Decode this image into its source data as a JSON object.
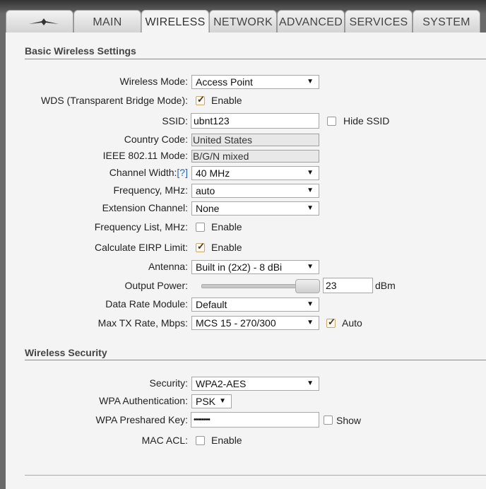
{
  "tabs": [
    {
      "label": "MAIN"
    },
    {
      "label": "WIRELESS"
    },
    {
      "label": "NETWORK"
    },
    {
      "label": "ADVANCED"
    },
    {
      "label": "SERVICES"
    },
    {
      "label": "SYSTEM"
    }
  ],
  "active_tab": "WIRELESS",
  "basic": {
    "title": "Basic Wireless Settings",
    "wireless_mode": {
      "label": "Wireless Mode:",
      "value": "Access Point"
    },
    "wds": {
      "label": "WDS (Transparent Bridge Mode):",
      "option": "Enable",
      "checked": true
    },
    "ssid": {
      "label": "SSID:",
      "value": "ubnt123",
      "hide_label": "Hide SSID",
      "hide_checked": false
    },
    "country": {
      "label": "Country Code:",
      "value": "United States"
    },
    "ieee": {
      "label": "IEEE 802.11 Mode:",
      "value": "B/G/N mixed"
    },
    "channel_width": {
      "label": "Channel Width:",
      "help": "[?]",
      "value": "40 MHz"
    },
    "frequency": {
      "label": "Frequency, MHz:",
      "value": "auto"
    },
    "ext_channel": {
      "label": "Extension Channel:",
      "value": "None"
    },
    "freq_list": {
      "label": "Frequency List, MHz:",
      "option": "Enable",
      "checked": false
    },
    "eirp": {
      "label": "Calculate EIRP Limit:",
      "option": "Enable",
      "checked": true
    },
    "antenna": {
      "label": "Antenna:",
      "value": "Built in (2x2) - 8 dBi"
    },
    "output_power": {
      "label": "Output Power:",
      "value": "23",
      "unit": "dBm"
    },
    "data_rate": {
      "label": "Data Rate Module:",
      "value": "Default"
    },
    "max_tx": {
      "label": "Max TX Rate, Mbps:",
      "value": "MCS 15 - 270/300",
      "auto_label": "Auto",
      "auto_checked": true
    }
  },
  "security": {
    "title": "Wireless Security",
    "security": {
      "label": "Security:",
      "value": "WPA2-AES"
    },
    "wpa_auth": {
      "label": "WPA Authentication:",
      "value": "PSK"
    },
    "psk": {
      "label": "WPA Preshared Key:",
      "value": "••••••••",
      "show_label": "Show",
      "show_checked": false
    },
    "mac_acl": {
      "label": "MAC ACL:",
      "option": "Enable",
      "checked": false
    }
  },
  "icons": {
    "logo": "ubiquiti-logo-icon",
    "dropdown": "chevron-down-icon",
    "checkbox": "checkmark-icon"
  }
}
